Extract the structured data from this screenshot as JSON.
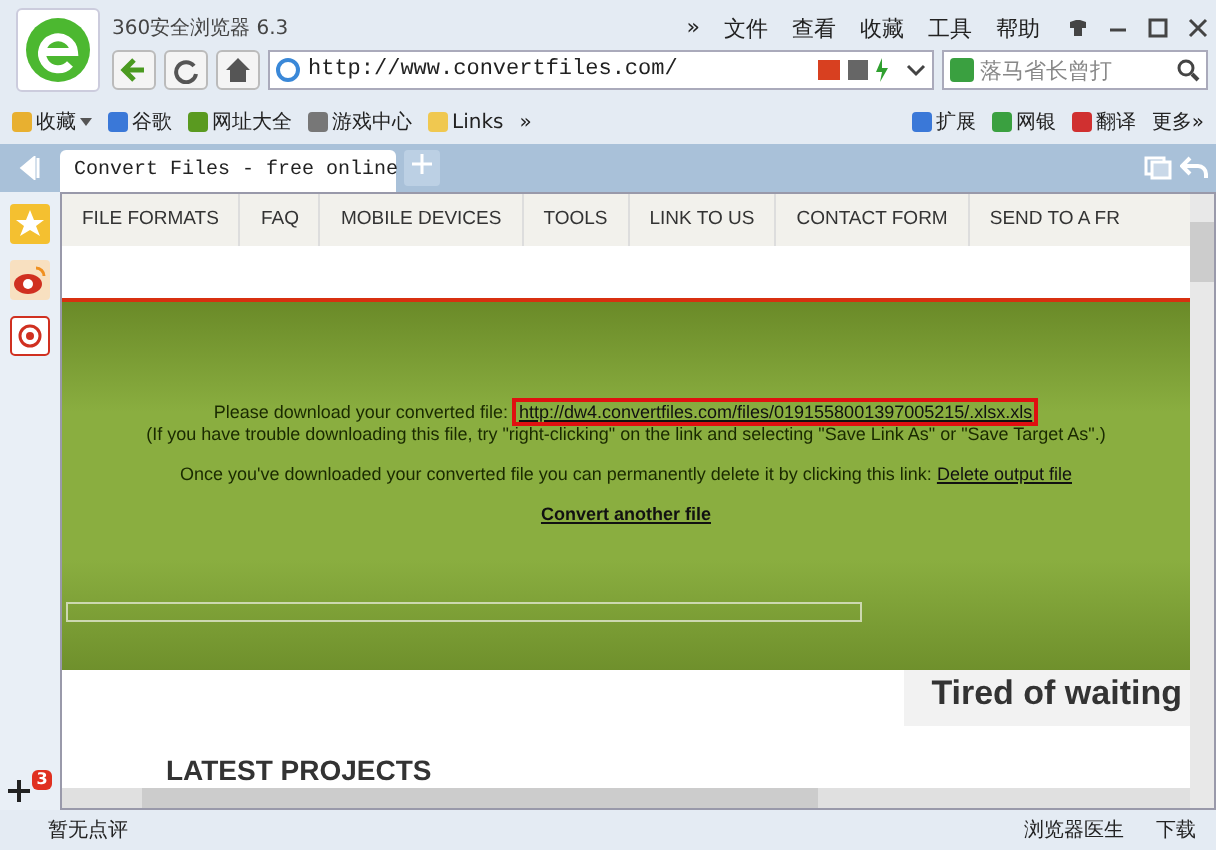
{
  "window": {
    "title": "360安全浏览器 6.3"
  },
  "menu": [
    "»",
    "文件",
    "查看",
    "收藏",
    "工具",
    "帮助"
  ],
  "address_bar": {
    "value": "http://www.convertfiles.com/"
  },
  "search": {
    "placeholder": "落马省长曾打"
  },
  "bookmarks": [
    {
      "label": "收藏",
      "kind": "fav",
      "dropdown": true
    },
    {
      "label": "谷歌",
      "kind": "google",
      "dropdown": false
    },
    {
      "label": "网址大全",
      "kind": "sites",
      "dropdown": false
    },
    {
      "label": "游戏中心",
      "kind": "game",
      "dropdown": false
    },
    {
      "label": "Links",
      "kind": "folder",
      "dropdown": false
    },
    {
      "label": "»",
      "kind": "more",
      "dropdown": false
    }
  ],
  "extensions": [
    {
      "label": "扩展",
      "kind": "ext"
    },
    {
      "label": "网银",
      "kind": "bank"
    },
    {
      "label": "翻译",
      "kind": "translate"
    },
    {
      "label": "更多»",
      "kind": "more"
    }
  ],
  "tabs": [
    {
      "label": "Convert Files - free online",
      "selected": true
    }
  ],
  "sidebar": {
    "badge": "3"
  },
  "nav": [
    "FILE FORMATS",
    "FAQ",
    "MOBILE DEVICES",
    "TOOLS",
    "LINK TO US",
    "CONTACT FORM",
    "SEND TO A FR"
  ],
  "result": {
    "intro": "Please download your converted file:",
    "link": "http://dw4.convertfiles.com/files/0191558001397005215/.xlsx.xls",
    "hint": "(If you have trouble downloading this file, try \"right-clicking\" on the link and selecting \"Save Link As\" or \"Save Target As\".)",
    "delete_text": "Once you've downloaded your converted file you can permanently delete it by clicking this link:",
    "delete_link": "Delete output file",
    "convert_link": "Convert another file"
  },
  "ad": {
    "title": "Tired of waiting"
  },
  "section_title": "LATEST PROJECTS",
  "status_bar": {
    "review": "暂无点评",
    "doctor": "浏览器医生",
    "download": "下载"
  }
}
